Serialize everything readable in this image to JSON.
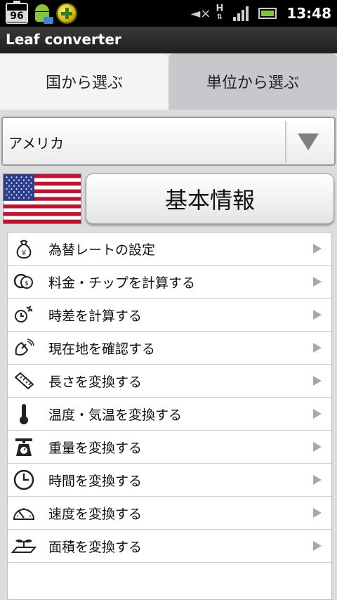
{
  "statusbar": {
    "battery_notification": "96",
    "network": "H",
    "time": "13:48"
  },
  "app": {
    "title": "Leaf converter"
  },
  "tabs": [
    {
      "label": "国から選ぶ",
      "active": true
    },
    {
      "label": "単位から選ぶ",
      "active": false
    }
  ],
  "country_select": {
    "value": "アメリカ"
  },
  "basic_info_button": {
    "label": "基本情報"
  },
  "menu": [
    {
      "label": "為替レートの設定",
      "icon": "money-bag-icon"
    },
    {
      "label": "料金・チップを計算する",
      "icon": "coins-icon"
    },
    {
      "label": "時差を計算する",
      "icon": "clock-plane-icon"
    },
    {
      "label": "現在地を確認する",
      "icon": "satellite-dish-icon"
    },
    {
      "label": "長さを変換する",
      "icon": "ruler-icon"
    },
    {
      "label": "温度・気温を変換する",
      "icon": "thermometer-icon"
    },
    {
      "label": "重量を変換する",
      "icon": "scale-icon"
    },
    {
      "label": "時間を変換する",
      "icon": "clock-icon"
    },
    {
      "label": "速度を変換する",
      "icon": "speedometer-icon"
    },
    {
      "label": "面積を変換する",
      "icon": "sprout-area-icon"
    }
  ],
  "colors": {
    "statusbar": "#000000",
    "titlebar": "#2b2b2b",
    "tab_active": "#f4f4f4",
    "tab_inactive": "#c6c8cc"
  }
}
